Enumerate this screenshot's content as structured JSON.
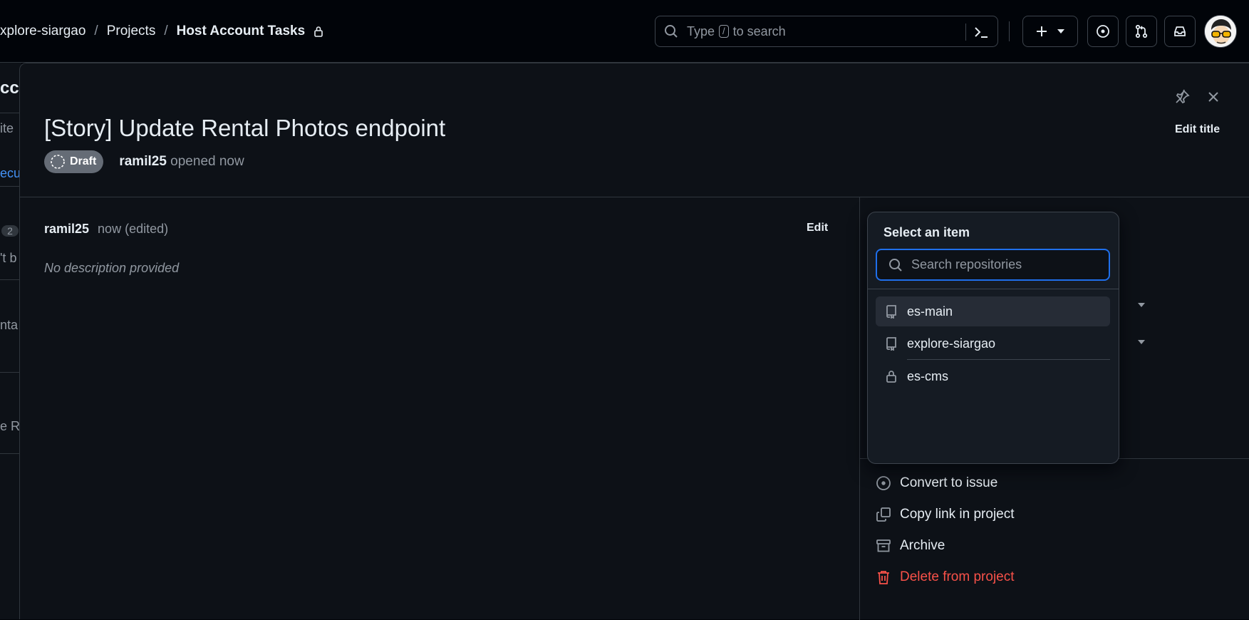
{
  "header": {
    "breadcrumb": {
      "org": "xplore-siargao",
      "sep1": "/",
      "projects": "Projects",
      "sep2": "/",
      "current": "Host Account Tasks"
    },
    "search": {
      "type_text": "Type",
      "key": "/",
      "to_search": "to search"
    }
  },
  "background_fragments": {
    "heading": "ccc",
    "items": "ite",
    "link": "ecur",
    "count": "2",
    "cant": "'t b",
    "nta": "nta",
    "er": "e R"
  },
  "panel": {
    "title": "[Story] Update Rental Photos endpoint",
    "edit_title": "Edit title",
    "status": "Draft",
    "author": "ramil25",
    "opened": "opened now",
    "comment": {
      "author": "ramil25",
      "time": "now (edited)",
      "edit": "Edit",
      "body": "No description provided"
    },
    "actions": [
      {
        "label": "Convert to issue",
        "icon": "issue-opened-icon"
      },
      {
        "label": "Copy link in project",
        "icon": "copy-icon"
      },
      {
        "label": "Archive",
        "icon": "archive-icon"
      },
      {
        "label": "Delete from project",
        "icon": "trash-icon"
      }
    ]
  },
  "select_overlay": {
    "title": "Select an item",
    "search_placeholder": "Search repositories",
    "items": [
      {
        "label": "es-main",
        "icon": "repo-icon"
      },
      {
        "label": "explore-siargao",
        "icon": "repo-icon"
      },
      {
        "label": "es-cms",
        "icon": "lock-icon"
      }
    ]
  },
  "colors": {
    "danger": "#f85149",
    "focus": "#1f6feb",
    "draft_badge": "#656c76"
  }
}
